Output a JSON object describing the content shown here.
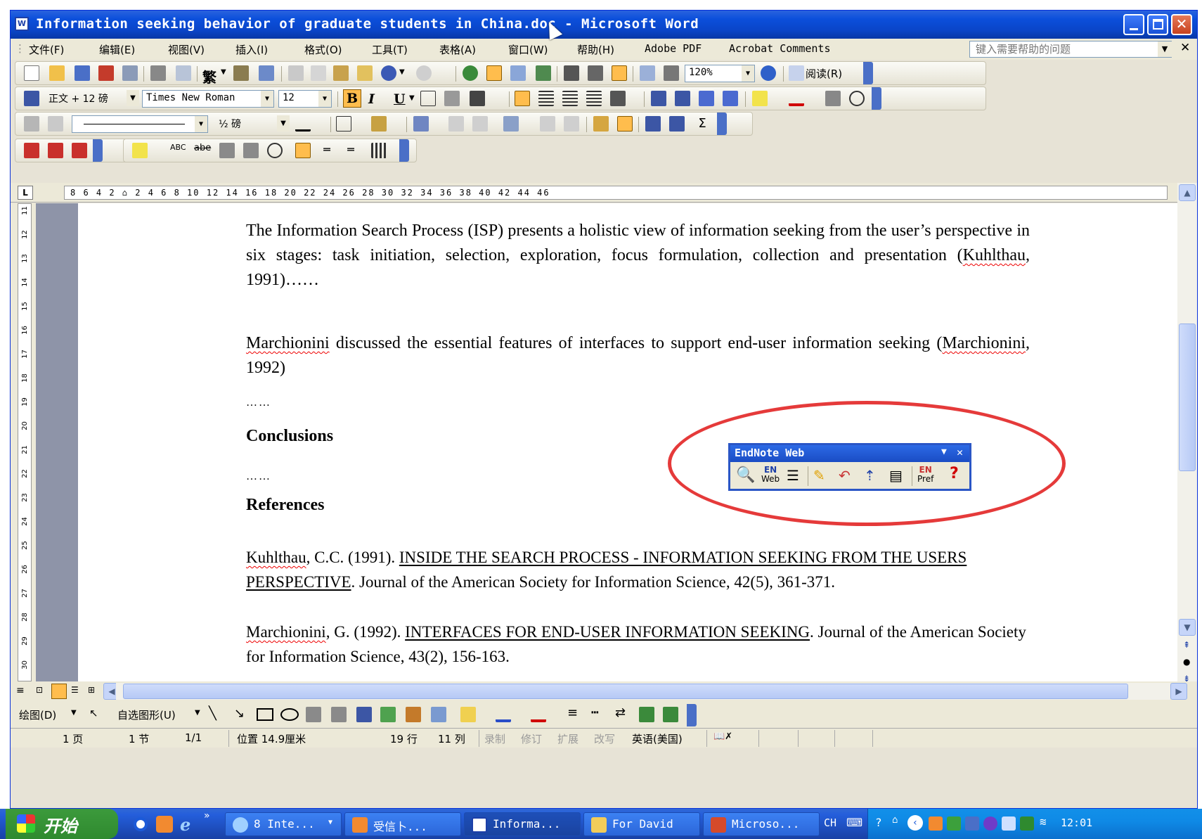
{
  "window": {
    "title": "Information seeking behavior of graduate students in China.doc - Microsoft Word",
    "app_icon": "W"
  },
  "menubar": {
    "items": [
      "文件(F)",
      "编辑(E)",
      "视图(V)",
      "插入(I)",
      "格式(O)",
      "工具(T)",
      "表格(A)",
      "窗口(W)",
      "帮助(H)",
      "Adobe PDF",
      "Acrobat Comments"
    ],
    "help_placeholder": "键入需要帮助的问题"
  },
  "toolbar_standard": {
    "traditional_label": "繁",
    "zoom": "120%",
    "read_label": "阅读(R)"
  },
  "toolbar_formatting": {
    "style": "正文 + 12 磅",
    "font": "Times New Roman",
    "size": "12",
    "bold": "B",
    "italic": "I",
    "underline": "U"
  },
  "toolbar_tables": {
    "line_weight": "½ 磅"
  },
  "ruler": {
    "horizontal": "8   6   4   2   ⌂   2   4   6   8   10   12   14   16   18   20   22   24   26   28   30   32   34   36   38   40   42   44   46",
    "vertical_ticks": [
      "11",
      "12",
      "13",
      "14",
      "15",
      "16",
      "17",
      "18",
      "19",
      "20",
      "21",
      "22",
      "23",
      "24",
      "25",
      "26",
      "27",
      "28",
      "29",
      "30"
    ]
  },
  "document": {
    "para1": {
      "before": "The Information Search Process (ISP) presents a holistic view of information seeking from the user’s perspective in six stages: task initiation, selection, exploration, focus formulation, collection and presentation (",
      "cite": "Kuhlthau",
      "after": ", 1991)……"
    },
    "para2": {
      "name": "Marchionini",
      "middle": " discussed the essential features of interfaces to support end-user information seeking (",
      "cite": "Marchionini",
      "after": ", 1992)"
    },
    "ellipsis1": "……",
    "conclusions_heading": "Conclusions",
    "ellipsis2": "……",
    "references_heading": "References",
    "refs": [
      {
        "author": "Kuhlthau",
        "pre": ", C.C. (1991). ",
        "title": "INSIDE THE SEARCH PROCESS - INFORMATION SEEKING FROM THE USERS PERSPECTIVE",
        "post": ". Journal of the American Society for Information Science, 42(5), 361-371."
      },
      {
        "author": "Marchionini",
        "pre": ", G. (1992). ",
        "title": "INTERFACES FOR END-USER INFORMATION SEEKING",
        "post": ". Journal of the American Society for Information Science, 43(2), 156-163."
      }
    ]
  },
  "endnote": {
    "title": "EndNote Web",
    "en_web_top": "EN",
    "en_web_bottom": "Web",
    "en_pref_top": "EN",
    "en_pref_bottom": "Pref",
    "help": "?"
  },
  "drawing_toolbar": {
    "draw_label": "绘图(D)",
    "autoshapes_label": "自选图形(U)"
  },
  "statusbar": {
    "page": "1 页",
    "section": "1 节",
    "pages": "1/1",
    "position": "位置 14.9厘米",
    "line": "19 行",
    "column": "11 列",
    "rec": "录制",
    "trk": "修订",
    "ext": "扩展",
    "ovr": "改写",
    "language": "英语(美国)"
  },
  "taskbar": {
    "start": "开始",
    "tasks": [
      "8 Inte...",
      "受信卜...",
      "Informa...",
      "For David",
      "Microso..."
    ],
    "lang": "CH",
    "clock": "12:01"
  },
  "colors": {
    "titlebar": "#0a45c8",
    "highlight_ring": "#e53a3a",
    "spell_squiggle": "#e00000",
    "button_highlight": "#ffbd4d"
  }
}
